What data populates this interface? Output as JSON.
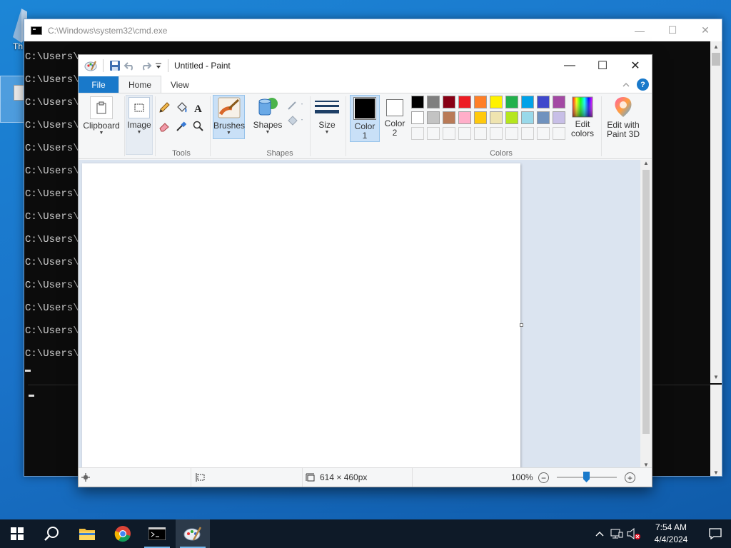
{
  "desktop": {
    "icon_label": "Th"
  },
  "cmd": {
    "title": "C:\\Windows\\system32\\cmd.exe",
    "lines": [
      "C:\\Users\\",
      "C:\\Users\\",
      "C:\\Users\\",
      "C:\\Users\\",
      "C:\\Users\\",
      "C:\\Users\\",
      "C:\\Users\\",
      "C:\\Users\\",
      "C:\\Users\\",
      "C:\\Users\\",
      "C:\\Users\\",
      "C:\\Users\\",
      "C:\\Users\\",
      "C:\\Users\\"
    ],
    "minimize": "—",
    "maximize": "☐",
    "close": "✕"
  },
  "paint": {
    "title": "Untitled - Paint",
    "minimize": "—",
    "maximize": "☐",
    "close": "✕",
    "tabs": {
      "file": "File",
      "home": "Home",
      "view": "View"
    },
    "help": "?",
    "groups": {
      "clipboard": "Clipboard",
      "image": "Image",
      "tools": "Tools",
      "brushes": "Brushes",
      "shapes_btn": "Shapes",
      "shapes": "Shapes",
      "size": "Size",
      "color1_a": "Color",
      "color1_b": "1",
      "color2_a": "Color",
      "color2_b": "2",
      "colors": "Colors",
      "edit_colors_a": "Edit",
      "edit_colors_b": "colors",
      "paint3d_a": "Edit with",
      "paint3d_b": "Paint 3D"
    },
    "palette_row1": [
      "#000000",
      "#7f7f7f",
      "#880015",
      "#ed1c24",
      "#ff7f27",
      "#fff200",
      "#22b14c",
      "#00a2e8",
      "#3f48cc",
      "#a349a4"
    ],
    "palette_row2": [
      "#ffffff",
      "#c3c3c3",
      "#b97a57",
      "#ffaec9",
      "#ffc90e",
      "#efe4b0",
      "#b5e61d",
      "#99d9ea",
      "#7092be",
      "#c8bfe7"
    ],
    "color1": "#000000",
    "color2": "#ffffff",
    "status": {
      "image_size": "614 × 460px",
      "zoom": "100%",
      "zoom_level_percent": 100
    }
  },
  "taskbar": {
    "time": "7:54 AM",
    "date": "4/4/2024"
  }
}
